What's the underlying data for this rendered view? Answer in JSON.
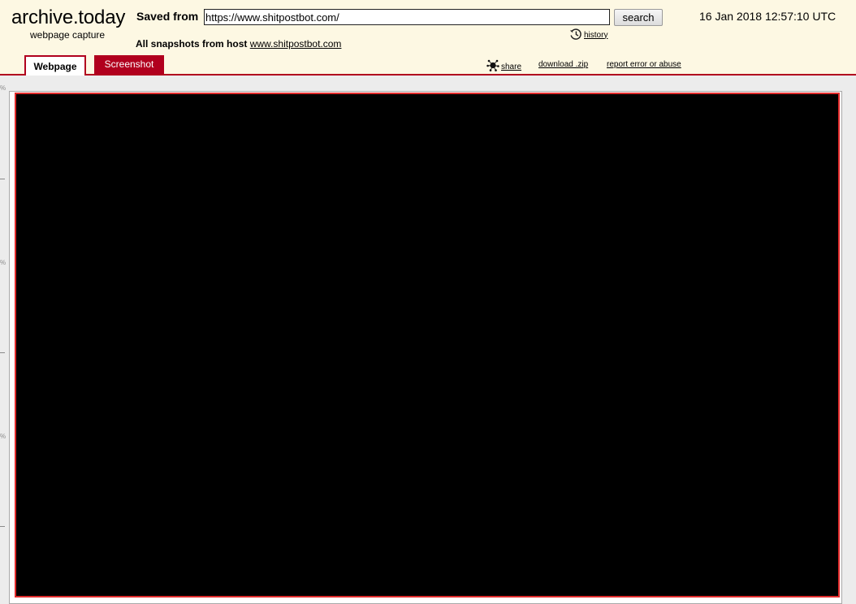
{
  "brand": {
    "logo": "archive.today",
    "tagline": "webpage capture"
  },
  "search": {
    "saved_from_label": "Saved from",
    "url_value": "https://www.shitpostbot.com/",
    "button_label": "search",
    "history_label": "history",
    "history_icon": "history-clock-icon"
  },
  "capture": {
    "date": "16 Jan 2018 12:57:10 UTC"
  },
  "snapshots": {
    "all_label": "All snapshots",
    "from_host_label": "from host",
    "host": "www.shitpostbot.com"
  },
  "tabs": [
    {
      "label": "Webpage",
      "active": true
    },
    {
      "label": "Screenshot",
      "active": false
    }
  ],
  "actions": {
    "share_label": "share",
    "share_icon": "share-icon",
    "download_label": "download .zip",
    "report_label": "report error or abuse"
  },
  "colors": {
    "header_bg": "#fdf8e3",
    "accent": "#b1001e",
    "capture_border": "#e02b2b",
    "capture_bg": "#000000"
  }
}
